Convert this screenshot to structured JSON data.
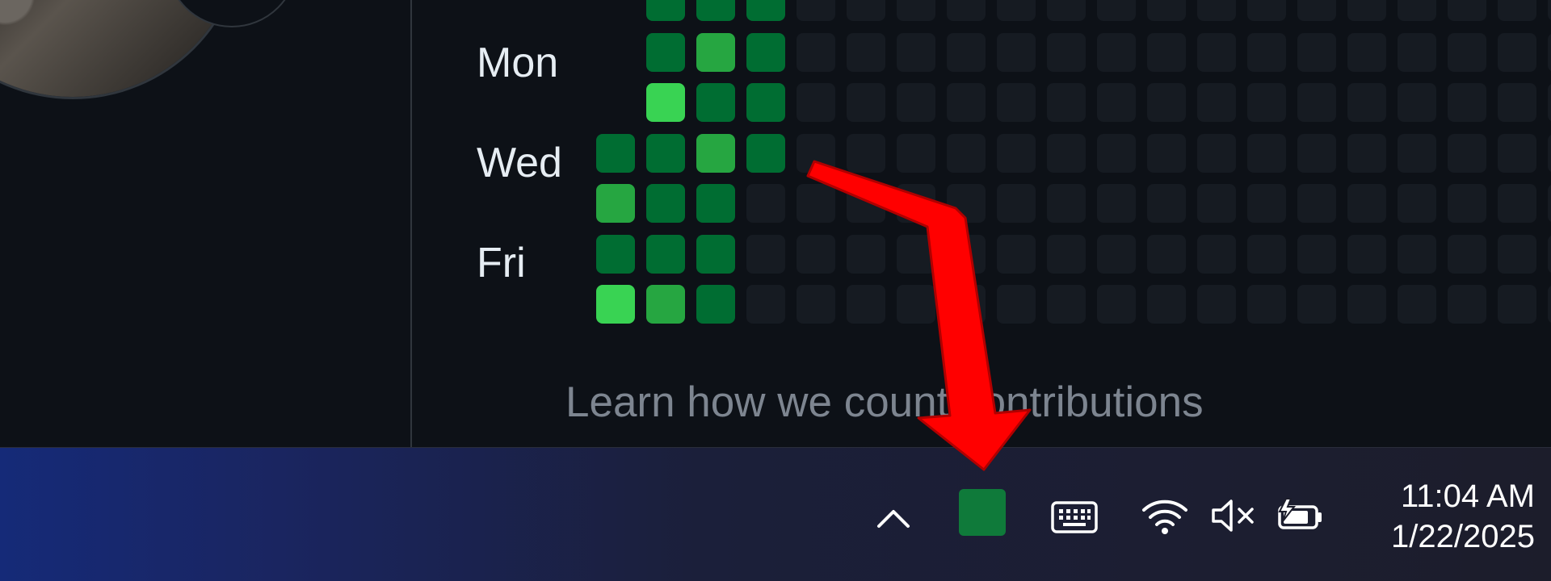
{
  "contributions": {
    "day_labels": [
      "Mon",
      "Wed",
      "Fri"
    ],
    "learn_link": "Learn how we count contributions",
    "colors": {
      "empty": "#161b22",
      "level1": "#0e4429",
      "level2": "#006d32",
      "level3": "#26a641",
      "level4": "#39d353"
    }
  },
  "taskbar": {
    "tray_app_icon": "green-app-icon",
    "clock_time": "11:04 AM",
    "clock_date": "1/22/2025",
    "icons": [
      "chevron-up-icon",
      "keyboard-icon",
      "wifi-icon",
      "volume-muted-icon",
      "battery-charging-icon"
    ]
  },
  "annotation": {
    "arrow_color": "#ff0000"
  }
}
